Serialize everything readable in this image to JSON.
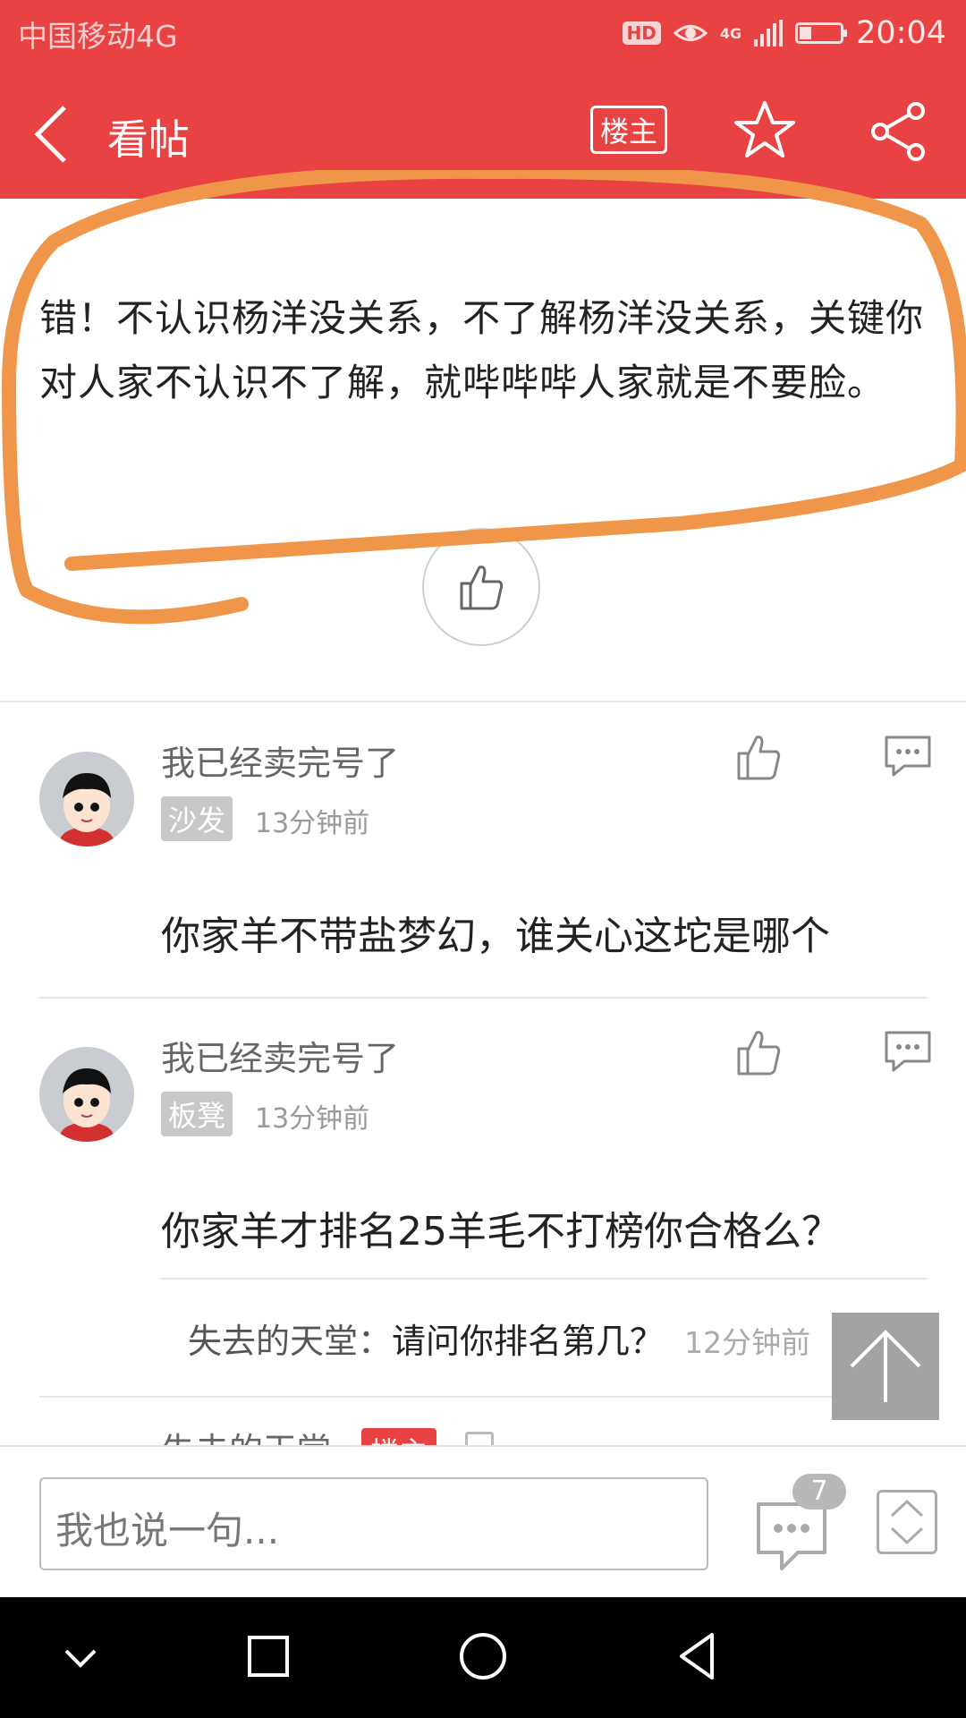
{
  "status_bar": {
    "carrier": "中国移动4G",
    "hd": "HD",
    "network": "4G",
    "time": "20:04",
    "battery_level": 0.3
  },
  "header": {
    "back_icon": "chevron-left-icon",
    "title": "看帖",
    "owner_label": "楼主",
    "favorite_icon": "star-icon",
    "share_icon": "share-icon"
  },
  "post": {
    "text": "错！不认识杨洋没关系，不了解杨洋没关系，关键你对人家不认识不了解，就哔哔哔人家就是不要脸。",
    "like_icon": "thumbs-up-icon"
  },
  "comments": [
    {
      "user": "我已经卖完号了",
      "floor": "沙发",
      "time": "13分钟前",
      "text": "你家羊不带盐梦幻，谁关心这坨是哪个"
    },
    {
      "user": "我已经卖完号了",
      "floor": "板凳",
      "time": "13分钟前",
      "text": "你家羊才排名25羊毛不打榜你合格么？",
      "reply": {
        "user": "失去的天堂：",
        "text": "请问你排名第几？",
        "time": "12分钟前"
      }
    }
  ],
  "partial_comment": {
    "user": "失去的天堂",
    "badge": "楼主"
  },
  "input_bar": {
    "placeholder": "我也说一句...",
    "message_count": "7"
  },
  "colors": {
    "brand": "#e84243",
    "annotation": "#f0964a"
  }
}
